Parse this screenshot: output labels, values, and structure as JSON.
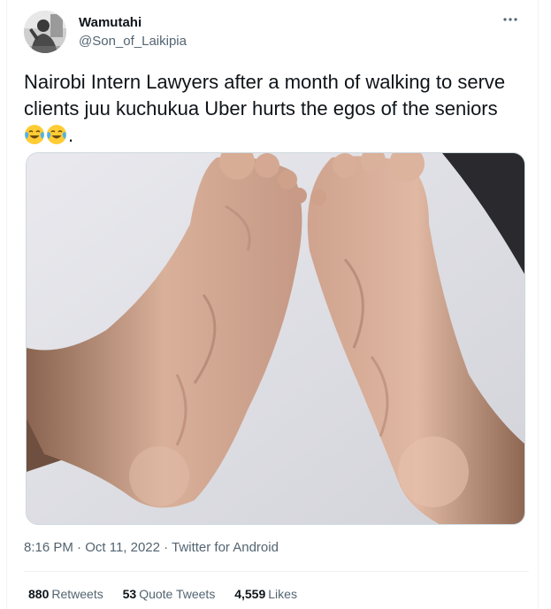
{
  "tweet": {
    "display_name": "Wamutahi",
    "handle": "@Son_of_Laikipia",
    "more_icon": "more-icon",
    "text": "Nairobi Intern Lawyers after a month of walking to serve clients juu kuchukua Uber hurts the egos of the seniors ",
    "text_suffix": ".",
    "emojis": [
      "face-with-tears-of-joy",
      "face-with-tears-of-joy"
    ],
    "time": "8:16 PM",
    "separator": " · ",
    "date": "Oct 11, 2022",
    "source": "Twitter for Android",
    "stats": {
      "retweets_count": "880",
      "retweets_label": "Retweets",
      "quotes_count": "53",
      "quotes_label": "Quote Tweets",
      "likes_count": "4,559",
      "likes_label": "Likes"
    }
  },
  "colors": {
    "text_primary": "#0f1419",
    "text_secondary": "#536471",
    "border": "#cfd9de"
  }
}
